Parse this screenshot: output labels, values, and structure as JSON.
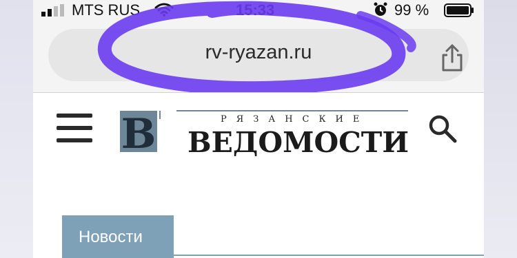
{
  "status_bar": {
    "carrier": "MTS RUS",
    "time": "15:33",
    "battery": "99 %"
  },
  "browser": {
    "url": "rv-ryazan.ru"
  },
  "site": {
    "logo_top": "РЯЗАНСКИЕ",
    "logo_main": "ВЕДОМОСТИ",
    "logo_letter": "В"
  },
  "news_tab": {
    "label": "Новости"
  },
  "colors": {
    "annotation": "#6a3cf0",
    "tab": "#7ea1b8",
    "logo_accent": "#6d8799"
  },
  "icons": [
    "signal-icon",
    "wifi-icon",
    "alarm-icon",
    "battery-icon",
    "share-icon",
    "menu-icon",
    "search-icon"
  ]
}
